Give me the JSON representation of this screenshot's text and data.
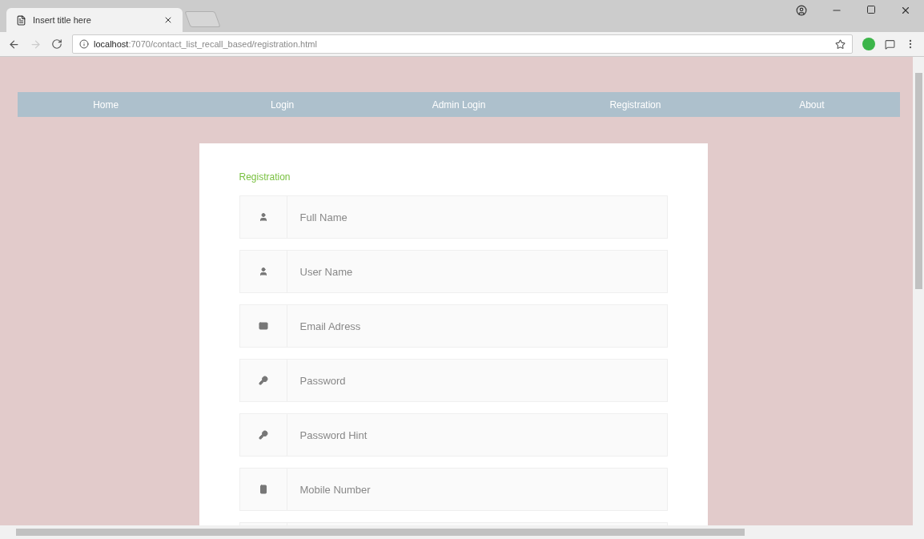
{
  "browser": {
    "tab": {
      "title": "Insert title here"
    },
    "url": {
      "host": "localhost",
      "path": ":7070/contact_list_recall_based/registration.html"
    }
  },
  "nav": {
    "items": [
      {
        "label": "Home",
        "selected": false
      },
      {
        "label": "Login",
        "selected": false
      },
      {
        "label": "Admin Login",
        "selected": false
      },
      {
        "label": "Registration",
        "selected": false
      },
      {
        "label": "About",
        "selected": false
      }
    ]
  },
  "form": {
    "title": "Registration",
    "fields": [
      {
        "kind": "person",
        "placeholder": "Full Name"
      },
      {
        "kind": "person",
        "placeholder": "User Name"
      },
      {
        "kind": "envelope",
        "placeholder": "Email Adress"
      },
      {
        "kind": "key",
        "placeholder": "Password"
      },
      {
        "kind": "key",
        "placeholder": "Password Hint"
      },
      {
        "kind": "mobile",
        "placeholder": "Mobile Number"
      },
      {
        "kind": "hidden"
      }
    ]
  }
}
